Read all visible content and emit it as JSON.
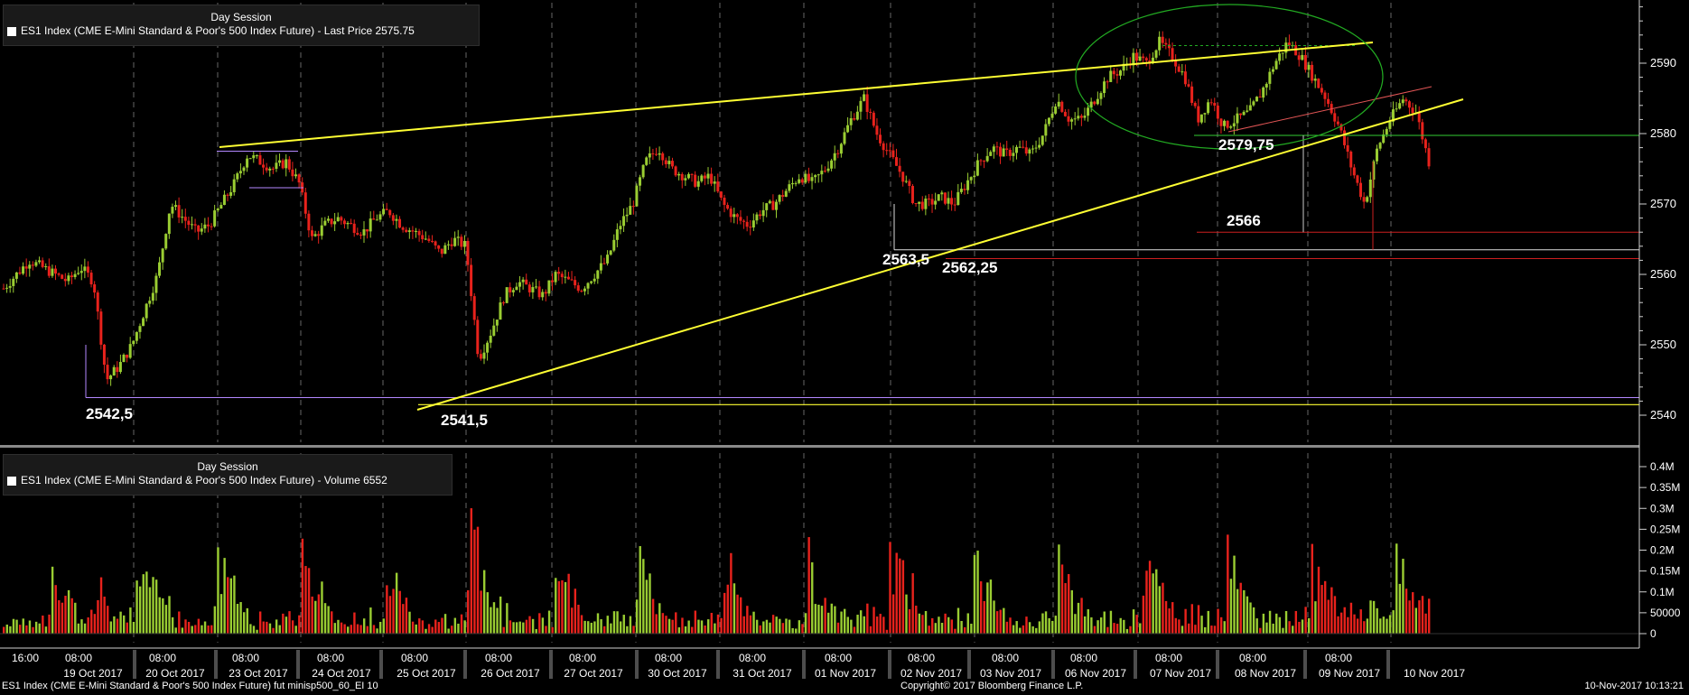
{
  "chart_data": [
    {
      "type": "candlestick",
      "title": "Day Session",
      "legend": "ES1 Index (CME E-Mini Standard & Poor's 500 Index Future) - Last Price 2575.75",
      "ylim": [
        2537,
        2600
      ],
      "yticks": [
        2540,
        2550,
        2560,
        2570,
        2580,
        2590
      ],
      "x_time_labels": [
        "16:00",
        "08:00",
        "08:00",
        "08:00",
        "08:00",
        "08:00",
        "08:00",
        "08:00",
        "08:00",
        "08:00",
        "08:00",
        "08:00",
        "08:00",
        "08:00",
        "08:00",
        "08:00",
        "08:00"
      ],
      "x_date_labels": [
        "19 Oct 2017",
        "20 Oct 2017",
        "23 Oct 2017",
        "24 Oct 2017",
        "25 Oct 2017",
        "26 Oct 2017",
        "27 Oct 2017",
        "30 Oct 2017",
        "31 Oct 2017",
        "01 Nov 2017",
        "02 Nov 2017",
        "03 Nov 2017",
        "06 Nov 2017",
        "07 Nov 2017",
        "08 Nov 2017",
        "09 Nov 2017",
        "10 Nov 2017"
      ],
      "hourly_close": [
        2558,
        2560,
        2562,
        2561,
        2560,
        2559,
        2561,
        2559,
        2545,
        2547,
        2550,
        2555,
        2560,
        2570,
        2568,
        2566,
        2567,
        2570,
        2573,
        2577,
        2576,
        2575,
        2576,
        2573,
        2565,
        2567,
        2568,
        2567,
        2566,
        2568,
        2569,
        2567,
        2566,
        2565,
        2563,
        2565,
        2564,
        2548,
        2552,
        2557,
        2559,
        2558,
        2557,
        2560,
        2559,
        2558,
        2560,
        2562,
        2567,
        2570,
        2576,
        2578,
        2575,
        2574,
        2573,
        2574,
        2570,
        2568,
        2567,
        2569,
        2570,
        2572,
        2574,
        2573,
        2575,
        2578,
        2582,
        2585,
        2580,
        2577,
        2574,
        2570,
        2570,
        2571,
        2570,
        2573,
        2576,
        2578,
        2577,
        2578,
        2577,
        2580,
        2585,
        2582,
        2582,
        2585,
        2588,
        2589,
        2591,
        2590,
        2593,
        2591,
        2588,
        2582,
        2585,
        2581,
        2582,
        2583,
        2586,
        2590,
        2593,
        2591,
        2588,
        2585,
        2581,
        2575,
        2570,
        2578,
        2582,
        2585,
        2583,
        2576
      ],
      "hourly_direction_note": "",
      "levels": [
        {
          "label": "2542,5",
          "value": 2542.5
        },
        {
          "label": "2541,5",
          "value": 2541.5
        },
        {
          "label": "2563,5",
          "value": 2563.5
        },
        {
          "label": "2562,25",
          "value": 2562.25
        },
        {
          "label": "2566",
          "value": 2566
        },
        {
          "label": "2579,75",
          "value": 2579.75
        }
      ]
    },
    {
      "type": "bar",
      "title": "Day Session",
      "legend": "ES1 Index (CME E-Mini Standard & Poor's 500 Index Future) - Volume 6552",
      "ylim": [
        0,
        420000
      ],
      "ytick_labels": [
        "0",
        "50000",
        "0.1M",
        "0.15M",
        "0.2M",
        "0.25M",
        "0.3M",
        "0.35M",
        "0.4M"
      ],
      "ytick_values": [
        0,
        50000,
        100000,
        150000,
        200000,
        250000,
        300000,
        350000,
        400000
      ],
      "last_value": 6552
    }
  ],
  "footer": {
    "left": "ES1 Index (CME E-Mini Standard & Poor's 500 Index Future) fut minisp500_60_EI 10",
    "center": "Copyright© 2017 Bloomberg Finance L.P.",
    "right": "10-Nov-2017 10:13:21"
  },
  "colors": {
    "up": "#9acd32",
    "down": "#e8221c",
    "trendline": "#ffff33",
    "ellipse": "#22aa22",
    "level_red": "#cc1f1f",
    "level_green": "#33cc33",
    "grid": "#666666",
    "purple": "#b388ff"
  }
}
